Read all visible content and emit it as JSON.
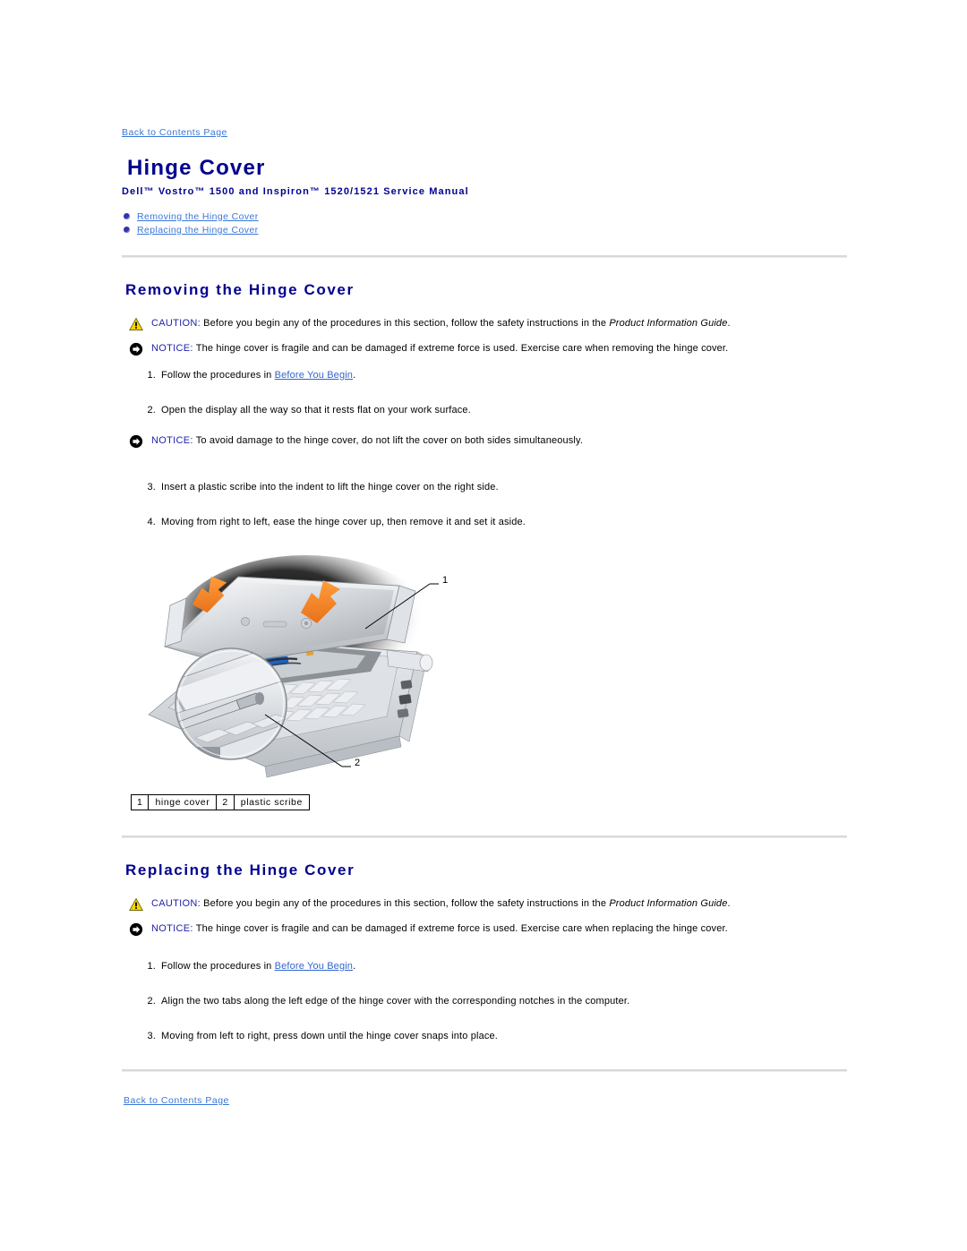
{
  "document": {
    "top_link": "Back to Contents Page",
    "bottom_link": "Back to Contents Page",
    "title": "Hinge Cover",
    "subtitle": "Dell™ Vostro™ 1500 and Inspiron™ 1520/1521 Service Manual",
    "title_color": "#00008f",
    "link_color": "#3a76d8",
    "alert_label_color": "#2222aa"
  },
  "toc": {
    "items": [
      {
        "label": "Removing the Hinge Cover"
      },
      {
        "label": "Replacing the Hinge Cover"
      }
    ]
  },
  "sections": [
    {
      "heading": "Removing the Hinge Cover",
      "caution": {
        "label": "CAUTION:",
        "text_before": " Before you begin any of the procedures in this section, follow the safety instructions in the ",
        "italic": "Product Information Guide",
        "text_after": "."
      },
      "notice": {
        "label": "NOTICE:",
        "text": " The hinge cover is fragile and can be damaged if extreme force is used. Exercise care when removing the hinge cover."
      },
      "steps": [
        {
          "text_before": "Follow the procedures in ",
          "link": "Before You Begin",
          "text_after": "."
        },
        {
          "text_before": "Open the display all the way so that it rests flat on your work surface."
        },
        {
          "text_before": "Insert a plastic scribe into the indent to lift the hinge cover on the right side."
        },
        {
          "text_before": "Moving from right to left, ease the hinge cover up, then remove it and set it aside."
        }
      ],
      "mid_notice": {
        "label": "NOTICE:",
        "text": " To avoid damage to the hinge cover, do not lift the cover on both sides simultaneously."
      }
    },
    {
      "heading": "Replacing the Hinge Cover",
      "caution": {
        "label": "CAUTION:",
        "text_before": " Before you begin any of the procedures in this section, follow the safety instructions in the ",
        "italic": "Product Information Guide",
        "text_after": "."
      },
      "notice": {
        "label": "NOTICE:",
        "text": " The hinge cover is fragile and can be damaged if extreme force is used. Exercise care when replacing the hinge cover."
      },
      "steps": [
        {
          "text_before": "Follow the procedures in ",
          "link": "Before You Begin",
          "text_after": "."
        },
        {
          "text_before": "Align the two tabs along the left edge of the hinge cover with the corresponding notches in the computer."
        },
        {
          "text_before": "Moving from left to right, press down until the hinge cover snaps into place."
        }
      ]
    }
  ],
  "figure": {
    "alt": "Laptop with hinge cover being lifted and plastic scribe inset detail",
    "callouts": [
      {
        "number": "1"
      },
      {
        "number": "2"
      }
    ],
    "legend": [
      {
        "index": "1",
        "label": "hinge cover"
      },
      {
        "index": "2",
        "label": "plastic scribe"
      }
    ]
  },
  "icons": {
    "caution": "warning-triangle-icon",
    "notice": "notice-arrow-icon"
  }
}
